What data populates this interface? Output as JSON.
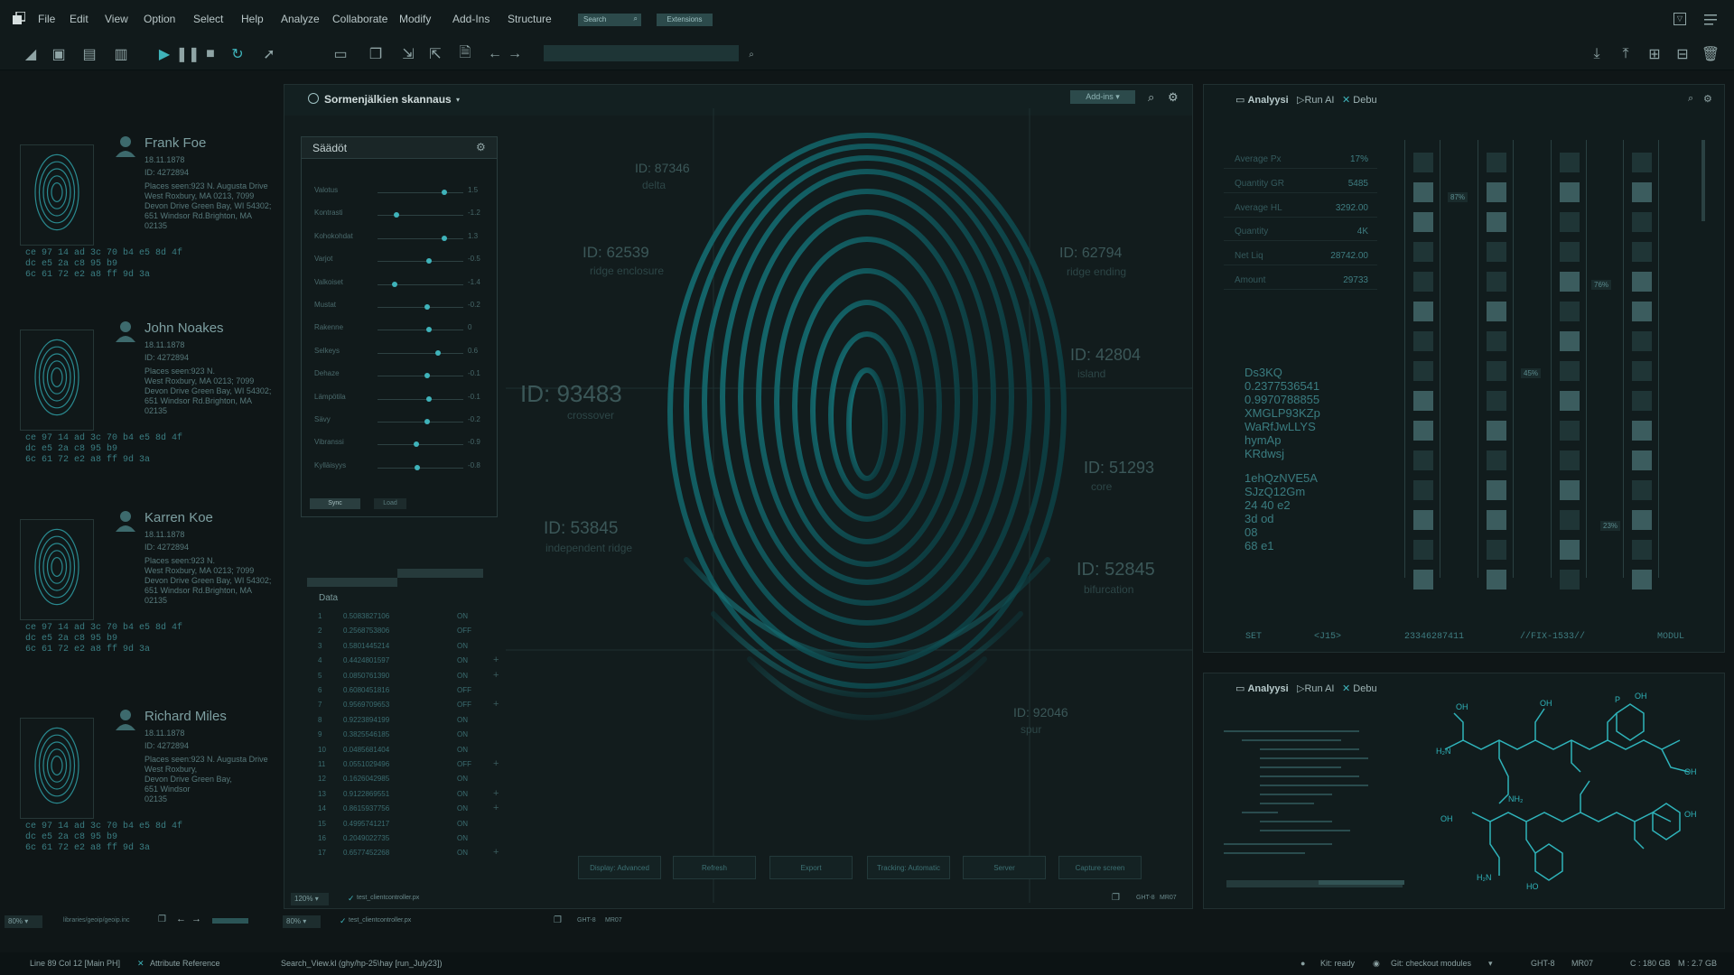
{
  "menubar": {
    "items": [
      "File",
      "Edit",
      "View",
      "Option",
      "Select",
      "Help",
      "Analyze",
      "Collaborate",
      "Modify",
      "Add-Ins",
      "Structure"
    ],
    "search_label": "Search",
    "extensions_label": "Extensions"
  },
  "sidebar": {
    "cards": [
      {
        "name": "Frank Foe",
        "date": "18.11.1878",
        "id": "ID: 4272894",
        "places": [
          "Places seen:923 N. Augusta Drive",
          "West Roxbury, MA 0213, 7099",
          "Devon Drive Green Bay, WI 54302;",
          "651 Windsor Rd.Brighton, MA",
          "02135"
        ],
        "hex": [
          "ce 97 14 ad 3c 70 b4 e5 8d 4f",
          "dc e5 2a c8 95 b9",
          "6c 61 72 e2 a8 ff 9d 3a"
        ]
      },
      {
        "name": "John Noakes",
        "date": "18.11.1878",
        "id": "ID: 4272894",
        "places": [
          "Places seen:923 N.",
          "West Roxbury, MA 0213; 7099",
          "Devon Drive Green Bay, WI 54302;",
          "651 Windsor Rd.Brighton, MA",
          "02135"
        ],
        "hex": [
          "ce 97 14 ad 3c 70 b4 e5 8d 4f",
          "dc e5 2a c8 95 b9",
          "6c 61 72 e2 a8 ff 9d 3a"
        ]
      },
      {
        "name": "Karren Koe",
        "date": "18.11.1878",
        "id": "ID: 4272894",
        "places": [
          "Places seen:923 N.",
          "West Roxbury, MA 0213; 7099",
          "Devon Drive Green Bay, WI 54302;",
          "651 Windsor Rd.Brighton, MA",
          "02135"
        ],
        "hex": [
          "ce 97 14 ad 3c 70 b4 e5 8d 4f",
          "dc e5 2a c8 95 b9",
          "6c 61 72 e2 a8 ff 9d 3a"
        ]
      },
      {
        "name": "Richard Miles",
        "date": "18.11.1878",
        "id": "ID: 4272894",
        "places": [
          "Places seen:923 N. Augusta Drive",
          "West Roxbury,",
          "Devon Drive Green Bay,",
          "651 Windsor",
          "02135"
        ],
        "hex": [
          "ce 97 14 ad 3c 70 b4 e5 8d 4f",
          "dc e5 2a c8 95 b9",
          "6c 61 72 e2 a8 ff 9d 3a"
        ]
      }
    ],
    "footer": {
      "zoom": "80%",
      "path": "libraries/geoip/geoip.inc"
    }
  },
  "main_panel": {
    "title": "Sormenjälkien skannaus",
    "addins_label": "Add-ins",
    "settings": {
      "title": "Säädöt",
      "sliders": [
        {
          "label": "Valotus",
          "value": "1.5",
          "pos": 0.78
        },
        {
          "label": "Kontrasti",
          "value": "-1.2",
          "pos": 0.22
        },
        {
          "label": "Kohokohdat",
          "value": "1.3",
          "pos": 0.78
        },
        {
          "label": "Varjot",
          "value": "-0.5",
          "pos": 0.6
        },
        {
          "label": "Valkoiset",
          "value": "-1.4",
          "pos": 0.2
        },
        {
          "label": "Mustat",
          "value": "-0.2",
          "pos": 0.58
        },
        {
          "label": "Rakenne",
          "value": "0",
          "pos": 0.6
        },
        {
          "label": "Selkeys",
          "value": "0.6",
          "pos": 0.7
        },
        {
          "label": "Dehaze",
          "value": "-0.1",
          "pos": 0.58
        },
        {
          "label": "Lämpötila",
          "value": "-0.1",
          "pos": 0.6
        },
        {
          "label": "Sävy",
          "value": "-0.2",
          "pos": 0.58
        },
        {
          "label": "Vibranssi",
          "value": "-0.9",
          "pos": 0.45
        },
        {
          "label": "Kylläisyys",
          "value": "-0.8",
          "pos": 0.46
        }
      ],
      "sync_label": "Sync",
      "load_label": "Load"
    },
    "data_table": {
      "title": "Data",
      "rows": [
        [
          "1",
          "0.5083827106",
          "ON"
        ],
        [
          "2",
          "0.2568753806",
          "OFF"
        ],
        [
          "3",
          "0.5801445214",
          "ON"
        ],
        [
          "4",
          "0.4424801597",
          "ON"
        ],
        [
          "5",
          "0.0850761390",
          "ON"
        ],
        [
          "6",
          "0.6080451816",
          "OFF"
        ],
        [
          "7",
          "0.9569709653",
          "OFF"
        ],
        [
          "8",
          "0.9223894199",
          "ON"
        ],
        [
          "9",
          "0.3825546185",
          "ON"
        ],
        [
          "10",
          "0.0485681404",
          "ON"
        ],
        [
          "11",
          "0.0551029496",
          "OFF"
        ],
        [
          "12",
          "0.1626042985",
          "ON"
        ],
        [
          "13",
          "0.9122869551",
          "ON"
        ],
        [
          "14",
          "0.8615937756",
          "ON"
        ],
        [
          "15",
          "0.4995741217",
          "ON"
        ],
        [
          "16",
          "0.2049022735",
          "ON"
        ],
        [
          "17",
          "0.6577452268",
          "ON"
        ]
      ]
    },
    "fp_labels": [
      {
        "id": "ID: 87346",
        "sub": "delta"
      },
      {
        "id": "ID: 62539",
        "sub": "ridge enclosure"
      },
      {
        "id": "ID: 62794",
        "sub": "ridge ending"
      },
      {
        "id": "ID: 42804",
        "sub": "island"
      },
      {
        "id": "ID: 93483",
        "sub": "crossover"
      },
      {
        "id": "ID: 51293",
        "sub": "core"
      },
      {
        "id": "ID: 53845",
        "sub": "independent ridge"
      },
      {
        "id": "ID: 52845",
        "sub": "bifurcation"
      },
      {
        "id": "ID: 92046",
        "sub": "spur"
      }
    ],
    "bottom_buttons": [
      "Display: Advanced",
      "Refresh",
      "Export",
      "Tracking: Automatic",
      "Server",
      "Capture screen"
    ],
    "footer": {
      "zoom": "120%",
      "file": "test_clientcontroller.px",
      "code1": "GHT-8",
      "code2": "MR07"
    }
  },
  "center_footer": {
    "zoom": "80%",
    "file": "test_clientcontroller.px",
    "code1": "GHT-8",
    "code2": "MR07"
  },
  "analysis_panel": {
    "tabs": [
      "Analyysi",
      "Run AI",
      "Debu"
    ],
    "stats": [
      {
        "label": "Average Px",
        "value": "17%"
      },
      {
        "label": "Quantity GR",
        "value": "5485"
      },
      {
        "label": "Average HL",
        "value": "3292.00"
      },
      {
        "label": "Quantity",
        "value": "4K"
      },
      {
        "label": "Net Liq",
        "value": "28742.00"
      },
      {
        "label": "Amount",
        "value": "29733"
      }
    ],
    "codes1": [
      "Ds3KQ",
      "0.2377536541",
      "0.9970788855",
      "XMGLP93KZp",
      "WaRfJwLLYS",
      "hymAp",
      "KRdwsj"
    ],
    "codes2": [
      "1ehQzNVE5A",
      "SJzQ12Gm",
      "24 40 e2",
      "3d od",
      "08",
      "68 e1"
    ],
    "percent_badges": [
      "87%",
      "45%",
      "76%",
      "23%"
    ],
    "footer": [
      "SET",
      "<J15>",
      "23346287411",
      "//FIX-1533//",
      "MODUL"
    ]
  },
  "chem_panel": {
    "tabs": [
      "Analyysi",
      "Run AI",
      "Debu"
    ]
  },
  "statusbar": {
    "line": "Line 89 Col 12 [Main PH]",
    "attr": "Attribute Reference",
    "view": "Search_View.kl (ghy/hp-25\\hay [run_July23])",
    "kit": "Kit: ready",
    "git": "Git: checkout modules",
    "code1": "GHT-8",
    "code2": "MR07",
    "disk": "C : 180 GB",
    "mem": "M : 2.7 GB"
  }
}
